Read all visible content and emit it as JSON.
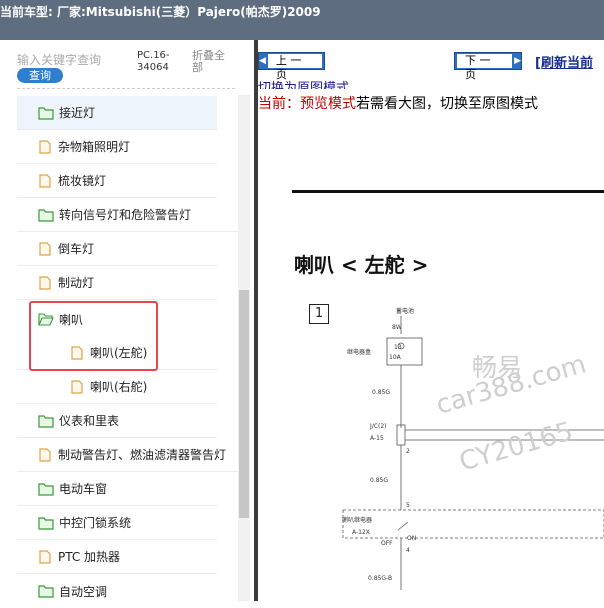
{
  "header": {
    "title": "当前车型:   厂家:Mitsubishi(三菱）Pajero(帕杰罗)2009"
  },
  "left_panel": {
    "search_placeholder": "输入关键字查询",
    "search_button": "查询",
    "pc_code": "PC.16-34064",
    "collapse_all": "折叠全部"
  },
  "tree": [
    {
      "label": "接近灯",
      "icon": "folder-icon"
    },
    {
      "label": "杂物箱照明灯",
      "icon": "document-icon"
    },
    {
      "label": "梳妆镜灯",
      "icon": "document-icon"
    },
    {
      "label": "转向信号灯和危险警告灯",
      "icon": "folder-icon"
    },
    {
      "label": "倒车灯",
      "icon": "document-icon"
    },
    {
      "label": "制动灯",
      "icon": "document-icon"
    },
    {
      "label": "喇叭",
      "icon": "folder-open-icon"
    },
    {
      "label": "喇叭(左舵)",
      "icon": "document-icon"
    },
    {
      "label": "喇叭(右舵)",
      "icon": "document-icon"
    },
    {
      "label": "仪表和里表",
      "icon": "folder-icon"
    },
    {
      "label": "制动警告灯、燃油滤清器警告灯",
      "icon": "document-icon"
    },
    {
      "label": "电动车窗",
      "icon": "folder-icon"
    },
    {
      "label": "中控门锁系统",
      "icon": "folder-icon"
    },
    {
      "label": "PTC 加热器",
      "icon": "document-icon"
    },
    {
      "label": "自动空调",
      "icon": "folder-icon"
    }
  ],
  "right_panel": {
    "prev_label": "上 一 页",
    "next_label": "下 一 页",
    "refresh_label": "[刷新当前",
    "mode_link": "切换为原图模式",
    "current_mode": "当前：预览模式",
    "mode_hint": "若需看大图，切换至原图模式",
    "doc_title": "喇叭 < 左舵 >",
    "section_number": "1",
    "diagram_labels": {
      "battery": "蓄电池",
      "wire_8w": "8W",
      "relay_box": "继电器盒",
      "fuse_no": "13",
      "fuse_amp": "10A",
      "wire_085g_1": "0.85G",
      "jc2": "J/C(2)",
      "a15": "A-15",
      "pin_2": "2",
      "pin_5": "5",
      "horn_relay": "喇叭继电器",
      "a12x": "A-12X",
      "off": "OFF",
      "on": "ON",
      "pin_4": "4",
      "wire_085g_b": "0.85G-B",
      "wire_085g_2": "0.85G"
    },
    "watermark": {
      "line1": "畅易",
      "line2": "car388.com",
      "line3": "CY20165"
    }
  }
}
